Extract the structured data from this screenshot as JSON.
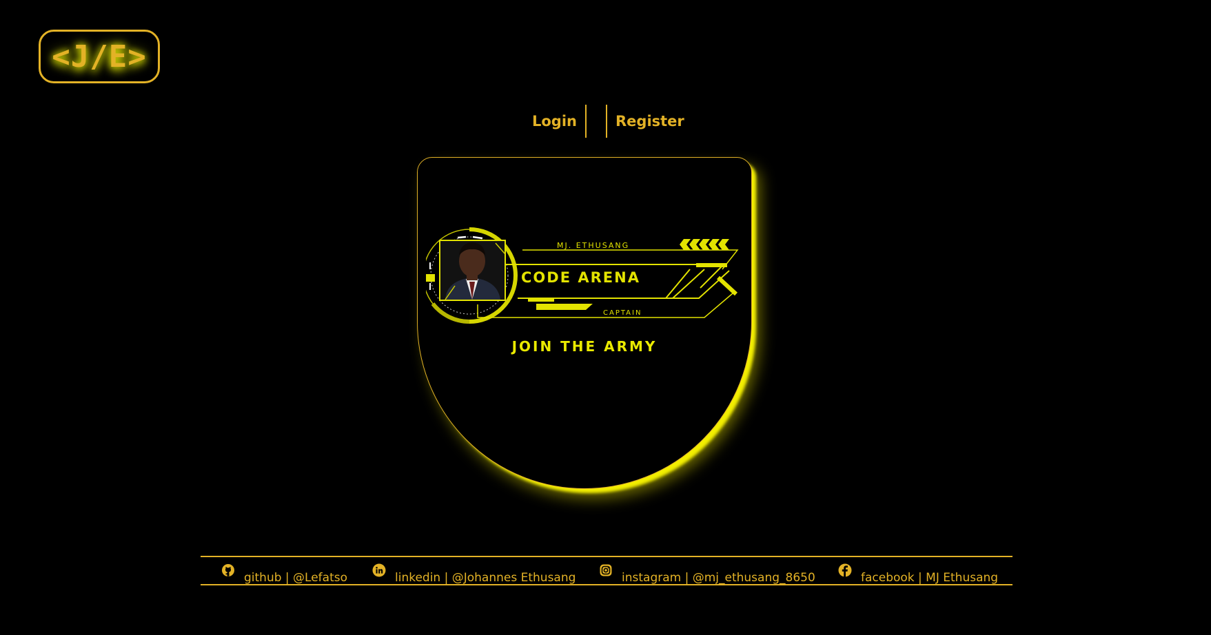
{
  "logo": {
    "text": "<J/E>"
  },
  "nav": {
    "login_label": "Login",
    "register_label": "Register"
  },
  "card": {
    "badge_name": "MJ. ETHUSANG",
    "badge_title": "CODE ARENA",
    "badge_role": "CAPTAIN",
    "cta_label": "JOIN THE ARMY"
  },
  "footer": {
    "links": [
      {
        "icon": "github-icon",
        "label": "github | @Lefatso"
      },
      {
        "icon": "linkedin-icon",
        "label": "linkedin | @Johannes Ethusang"
      },
      {
        "icon": "instagram-icon",
        "label": "instagram | @mj_ethusang_8650"
      },
      {
        "icon": "facebook-icon",
        "label": "facebook | MJ Ethusang"
      }
    ]
  },
  "colors": {
    "background": "#000000",
    "accent": "#e3b226",
    "neon": "#eaea00"
  }
}
